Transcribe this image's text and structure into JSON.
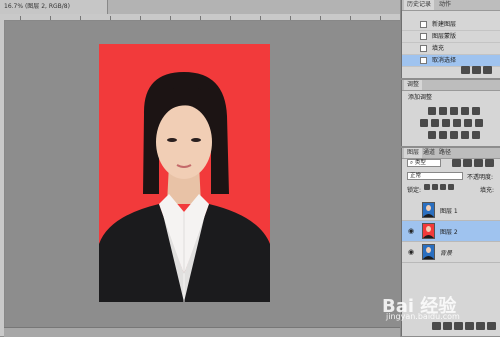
{
  "document": {
    "tab_title": "16.7% (图层 2, RGB/8)"
  },
  "history_panel": {
    "tabs": [
      "历史记录",
      "动作"
    ],
    "items": [
      {
        "label": "新建图层",
        "selected": false
      },
      {
        "label": "图层蒙版",
        "selected": false
      },
      {
        "label": "填充",
        "selected": false
      },
      {
        "label": "取消选择",
        "selected": true
      }
    ]
  },
  "adjustments_panel": {
    "tabs": [
      "调整"
    ],
    "title": "添加调整"
  },
  "layers_panel": {
    "tabs": [
      "图层",
      "通道",
      "路径"
    ],
    "filter_kind": "类型",
    "blend_mode": "正常",
    "opacity_label": "不透明度:",
    "lock_label": "锁定:",
    "fill_label": "填充:",
    "layers": [
      {
        "name": "图层 1",
        "visible": false,
        "selected": false
      },
      {
        "name": "图层 2",
        "visible": true,
        "selected": true
      },
      {
        "name": "背景",
        "visible": true,
        "selected": false
      }
    ]
  },
  "watermark": {
    "logo": "Bai 经验",
    "url": "jingyan.baidu.com"
  },
  "colors": {
    "canvas_background": "#f23a3b",
    "workspace": "#8d8d8d",
    "selection": "#9fc3ef"
  }
}
